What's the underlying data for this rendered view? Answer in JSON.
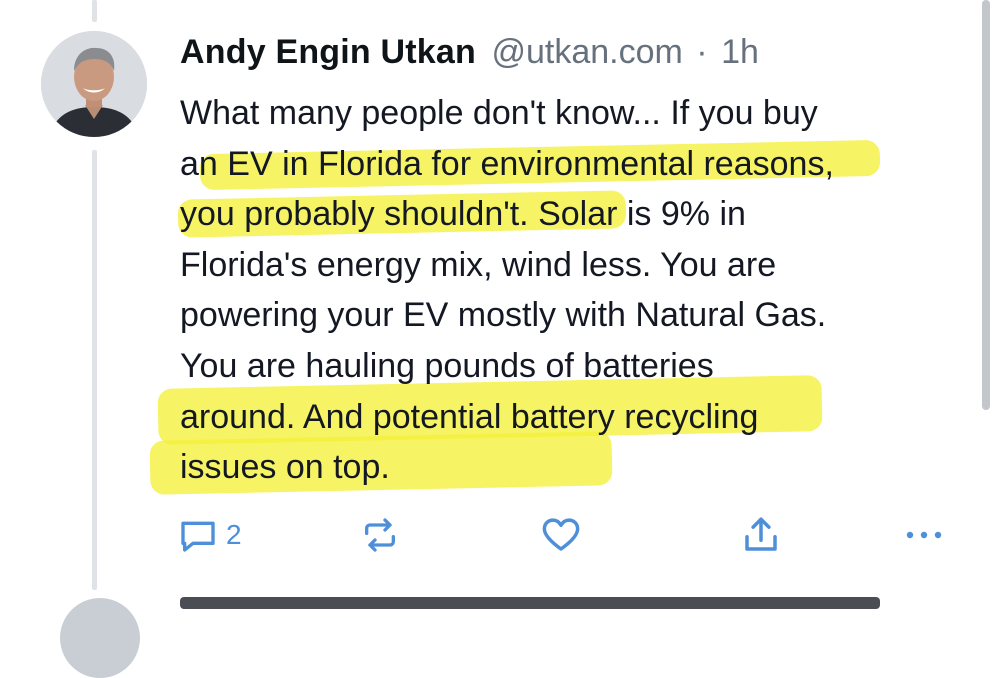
{
  "post": {
    "author_name": "Andy Engin Utkan",
    "handle": "@utkan.com",
    "separator": "·",
    "time": "1h",
    "text_lines": [
      "What many people don't know... If you buy",
      "an EV in Florida for environmental reasons,",
      "you probably shouldn't. Solar is 9% in",
      "Florida's energy mix, wind less. You are",
      "powering your EV mostly with Natural Gas.",
      "You are hauling pounds of batteries",
      "around. And potential battery recycling",
      "issues on top."
    ],
    "highlight_color": "#f4f03a"
  },
  "actions": {
    "reply_icon": "reply-icon",
    "reply_count": "2",
    "repost_icon": "repost-icon",
    "like_icon": "heart-icon",
    "share_icon": "share-icon",
    "more_icon": "more-icon",
    "accent": "#4d8fd8"
  }
}
